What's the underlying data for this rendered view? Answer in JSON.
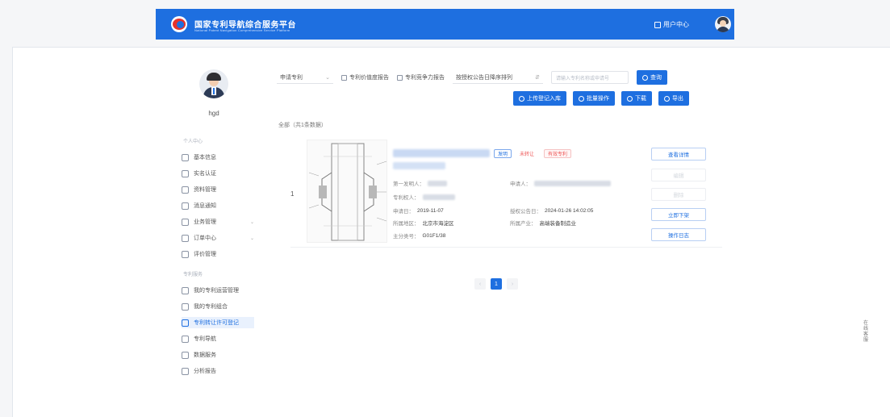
{
  "header": {
    "site_title": "国家专利导航综合服务平台",
    "site_subtitle": "National Patent Navigation Comprehensive Service Platform",
    "user_center": "用户中心"
  },
  "sidebar": {
    "username": "hgd",
    "section_personal": "个人中心",
    "personal_items": [
      {
        "label": "基本信息",
        "icon": "user-icon"
      },
      {
        "label": "实名认证",
        "icon": "id-card-icon"
      },
      {
        "label": "资料管理",
        "icon": "folder-icon"
      },
      {
        "label": "消息通知",
        "icon": "bell-icon"
      },
      {
        "label": "业务管理",
        "icon": "briefcase-icon",
        "caret": "⌄"
      },
      {
        "label": "订单中心",
        "icon": "cart-icon",
        "caret": "⌄"
      },
      {
        "label": "评价管理",
        "icon": "star-icon"
      }
    ],
    "section_services": "专利服务",
    "service_items": [
      {
        "label": "我的专利运营管理",
        "icon": "chart-icon"
      },
      {
        "label": "我的专利组合",
        "icon": "grid-icon"
      },
      {
        "label": "专利转让许可登记",
        "icon": "doc-icon",
        "active": true
      },
      {
        "label": "专利导航",
        "icon": "compass-icon"
      },
      {
        "label": "数据服务",
        "icon": "database-icon"
      },
      {
        "label": "分析报告",
        "icon": "report-icon"
      }
    ]
  },
  "toolbar": {
    "select_label": "申请专利",
    "select_arrow": "⌄",
    "checkbox1": "专利价值度报告",
    "checkbox2": "专利竞争力报告",
    "sort_label": "按授权公告日降序排列",
    "sort_arrow": "⇵",
    "search_placeholder": "请输入专利名称或申请号",
    "search_button": "查询",
    "btn_upload": "上传登记入库",
    "btn_batch": "批量操作",
    "btn_download": "下载",
    "btn_export": "导出"
  },
  "breadcrumb": "全部（共1条数据）",
  "results": [
    {
      "index": "1",
      "badge_type": "发明",
      "badge_status": "未转让",
      "badge_valid": "有效专利",
      "labels": {
        "first_inventor": "第一发明人：",
        "applicant": "申请人：",
        "patentee": "专利权人：",
        "apply_date": "申请日：",
        "grant_date": "授权公告日：",
        "region": "所属地区：",
        "industry": "所属产业：",
        "ipc": "主分类号："
      },
      "apply_date": "2019-11-07",
      "grant_date": "2024-01-26 14:02:05",
      "region": "北京市海淀区",
      "industry": "高端装备制造业",
      "ipc": "G01F1/38",
      "actions": {
        "detail": "查看详情",
        "edit": "编辑",
        "delete": "删除",
        "listing": "立即下架",
        "history": "操作日志"
      }
    }
  ],
  "pagination": {
    "prev": "‹",
    "current": "1",
    "next": "›"
  },
  "float_tool": "在线客服"
}
